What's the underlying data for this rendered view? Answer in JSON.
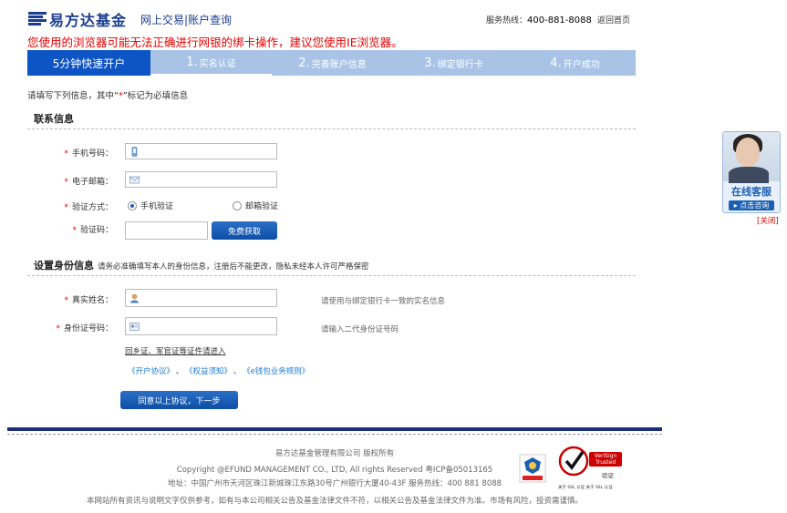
{
  "header": {
    "logo_text": "易方达基金",
    "subtitle": "网上交易|账户查询",
    "hotline_label": "服务热线：",
    "hotline_number": "400-881-8088",
    "home_link": "返回首页",
    "warning": "您使用的浏览器可能无法正确进行网银的绑卡操作，建议您使用IE浏览器。"
  },
  "steps": {
    "title": "5分钟快速开户",
    "items": [
      {
        "num": "1.",
        "label": "实名认证"
      },
      {
        "num": "2.",
        "label": "完善账户信息"
      },
      {
        "num": "3.",
        "label": "绑定银行卡"
      },
      {
        "num": "4.",
        "label": "开户成功"
      }
    ]
  },
  "intro": {
    "before": "请填写下列信息，其中“",
    "star": "*",
    "after": "”标记为必填信息"
  },
  "contact": {
    "title": "联系信息",
    "phone_label": "手机号码：",
    "email_label": "电子邮箱：",
    "verify_method_label": "验证方式：",
    "radio_phone": "手机验证",
    "radio_email": "邮箱验证",
    "code_label": "验证码：",
    "get_code_button": "免费获取"
  },
  "identity": {
    "title": "设置身份信息",
    "note": "请务必准确填写本人的身份信息，注册后不能更改，隐私未经本人许可严格保密",
    "name_label": "真实姓名：",
    "name_hint": "请使用与绑定银行卡一致的实名信息",
    "id_label": "身份证号码：",
    "id_hint": "请输入二代身份证号码",
    "other_id_link": "回乡证、军官证等证件请进入",
    "protocols": [
      "《开户协议》",
      "《权益须知》",
      "《e钱包业务规则》"
    ],
    "protocol_sep": "、",
    "submit_button": "同意以上协议，下一步"
  },
  "footer": {
    "company": "易方达基金管理有限公司 版权所有",
    "copyright": "Copyright @EFUND MANAGEMENT CO., LTD, All rights Reserved 粤ICP备05013165",
    "address": "地址：中国广州市天河区珠江新城珠江东路30号广州银行大厦40-43F 服务热线：400 881 8088",
    "disclaimer": "本网站所有资讯与说明文字仅供参考，如有与本公司相关公告及基金法律文件不符，以相关公告及基金法律文件为准。市场有风险，投资需谨慎。",
    "badge_verisign": "VeriSign Trusted",
    "badge_verisign_sub": "验证",
    "badge_ssl": "关于 SSL 认证 关于 SSL 认证"
  },
  "service": {
    "title": "在线客服",
    "sub": "▸ 点击咨询",
    "close": "[关闭]"
  },
  "colors": {
    "brand": "#1a3d8f",
    "step_active": "#0d55c4",
    "step_bar": "#a8c3e6",
    "warning": "#e60000",
    "link": "#1a7ad8"
  }
}
